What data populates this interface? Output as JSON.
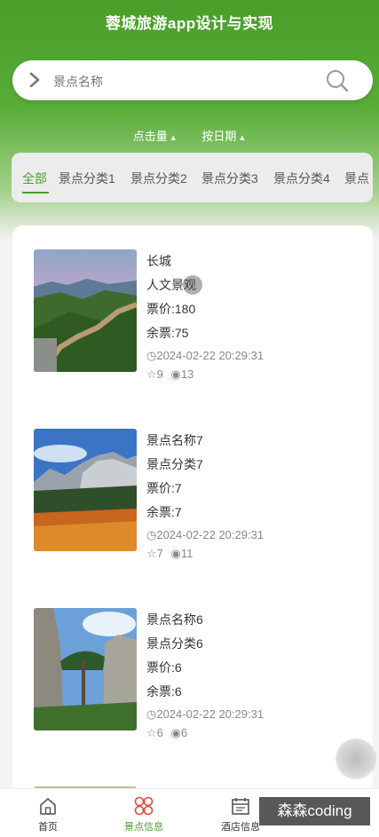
{
  "app": {
    "title": "蓉城旅游app设计与实现"
  },
  "search": {
    "placeholder": "景点名称",
    "value": ""
  },
  "sort": [
    {
      "label": "点击量"
    },
    {
      "label": "按日期"
    }
  ],
  "tabs": [
    {
      "label": "全部",
      "active": true
    },
    {
      "label": "景点分类1"
    },
    {
      "label": "景点分类2"
    },
    {
      "label": "景点分类3"
    },
    {
      "label": "景点分类4"
    },
    {
      "label": "景点"
    }
  ],
  "items": [
    {
      "name": "长城",
      "category": "人文景观",
      "price": "票价:180",
      "stock": "余票:75",
      "time": "2024-02-22 20:29:31",
      "stars": "9",
      "views": "13"
    },
    {
      "name": "景点名称7",
      "category": "景点分类7",
      "price": "票价:7",
      "stock": "余票:7",
      "time": "2024-02-22 20:29:31",
      "stars": "7",
      "views": "11"
    },
    {
      "name": "景点名称6",
      "category": "景点分类6",
      "price": "票价:6",
      "stock": "余票:6",
      "time": "2024-02-22 20:29:31",
      "stars": "6",
      "views": "6"
    }
  ],
  "nav": [
    {
      "label": "首页",
      "icon": "home-icon"
    },
    {
      "label": "景点信息",
      "icon": "clover-icon",
      "active": true
    },
    {
      "label": "酒店信息",
      "icon": "calendar-icon"
    }
  ],
  "watermark": "森森coding",
  "colors": {
    "primary": "#4a9e2a",
    "accent_red": "#e0473c"
  }
}
